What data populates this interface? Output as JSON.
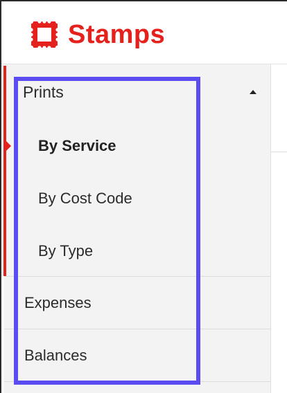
{
  "brand": {
    "name": "Stamps",
    "color": "#e5211d",
    "logo_icon": "stamp-icon"
  },
  "sidebar": {
    "sections": [
      {
        "label": "Prints",
        "expanded": true,
        "toggle_icon": "caret-up-icon",
        "children": [
          {
            "label": "By Service",
            "active": true
          },
          {
            "label": "By Cost Code",
            "active": false
          },
          {
            "label": "By Type",
            "active": false
          }
        ]
      },
      {
        "label": "Expenses"
      },
      {
        "label": "Balances"
      }
    ],
    "active_color": "#e5211d"
  },
  "highlight": {
    "color": "#5a4cf0"
  }
}
